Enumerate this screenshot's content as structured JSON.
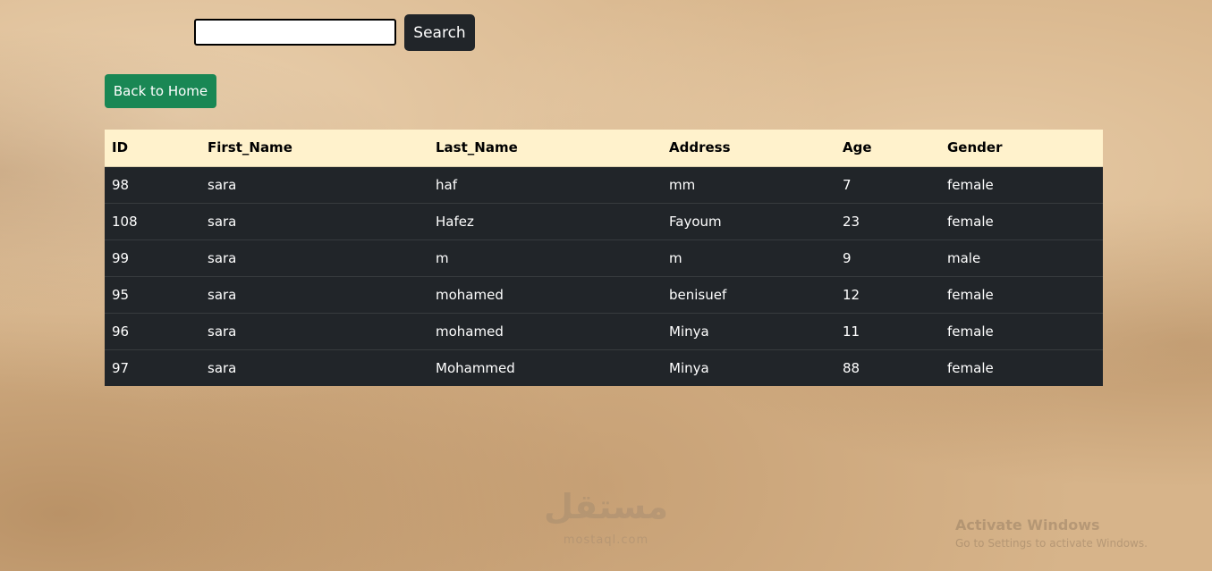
{
  "search": {
    "value": "",
    "button_label": "Search"
  },
  "nav": {
    "home_button_label": "Back to Home"
  },
  "table": {
    "columns": [
      "ID",
      "First_Name",
      "Last_Name",
      "Address",
      "Age",
      "Gender"
    ],
    "rows": [
      [
        "98",
        "sara",
        "haf",
        "mm",
        "7",
        "female"
      ],
      [
        "108",
        "sara",
        "Hafez",
        "Fayoum",
        "23",
        "female"
      ],
      [
        "99",
        "sara",
        "m",
        "m",
        "9",
        "male"
      ],
      [
        "95",
        "sara",
        "mohamed",
        "benisuef",
        "12",
        "female"
      ],
      [
        "96",
        "sara",
        "mohamed",
        "Minya",
        "11",
        "female"
      ],
      [
        "97",
        "sara",
        "Mohammed",
        "Minya",
        "88",
        "female"
      ]
    ]
  },
  "watermark": {
    "logo_text": "مستقل",
    "logo_subtext": "mostaql.com"
  },
  "os_notice": {
    "title": "Activate Windows",
    "subtitle": "Go to Settings to activate Windows."
  },
  "colors": {
    "header_bg": "#fff2cc",
    "row_bg": "#212529",
    "search_button_bg": "#212529",
    "home_button_bg": "#198754"
  }
}
